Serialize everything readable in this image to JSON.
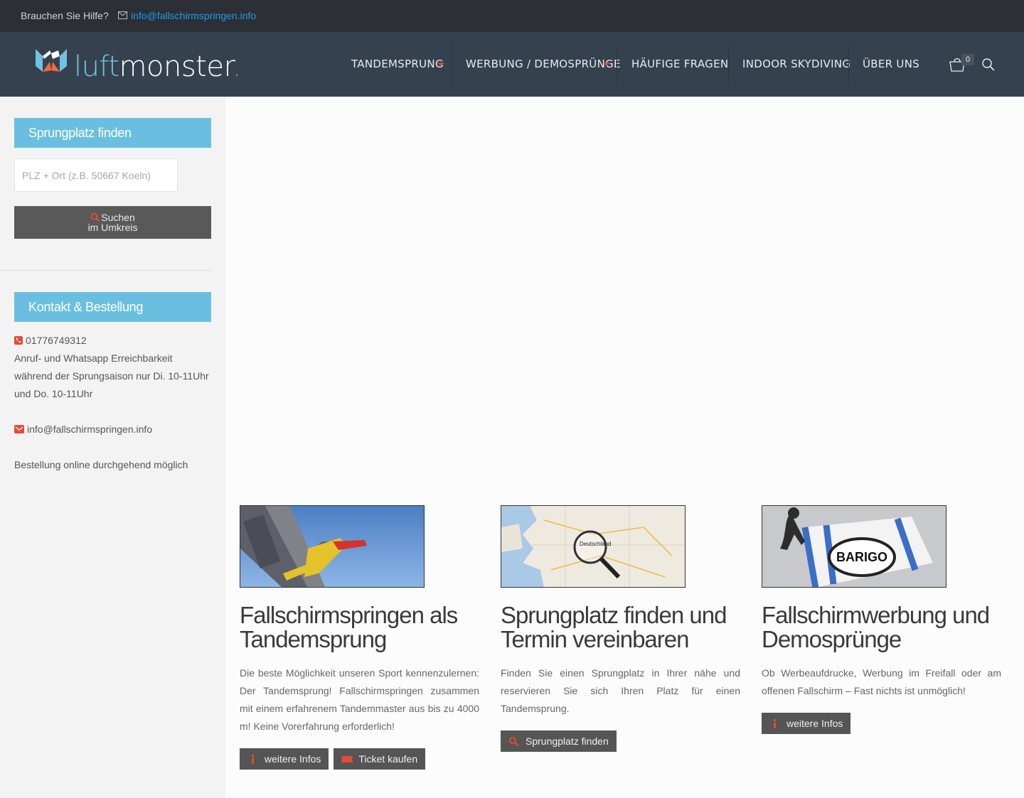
{
  "topbar": {
    "help_text": "Brauchen Sie Hilfe?",
    "email": "info@fallschirmspringen.info"
  },
  "brand": {
    "logo_part1": "luft",
    "logo_part2": "monster",
    "logo_dot": ".",
    "accent_color": "#6abfe0",
    "orange_color": "#f06a3b"
  },
  "nav": {
    "items": [
      {
        "label": "Tandemsprung",
        "has_dropdown": true
      },
      {
        "label": "Werbung / Demosprünge",
        "has_dropdown": true
      },
      {
        "label": "Häufige Fragen",
        "has_dropdown": false
      },
      {
        "label": "Indoor Skydiving",
        "has_dropdown": false
      },
      {
        "label": "Über uns",
        "has_dropdown": false
      }
    ],
    "cart_count": "0"
  },
  "sidebar": {
    "search_widget": {
      "title": "Sprungplatz finden",
      "placeholder": "PLZ + Ort (z.B. 50667 Koeln)",
      "button_line1": "Suchen",
      "button_line2": "im Umkreis"
    },
    "contact_widget": {
      "title": "Kontakt & Bestellung",
      "phone": "01776749312",
      "availability": "Anruf- und Whatsapp Erreichbarkeit während der Sprungsaison nur Di. 10-11Uhr und Do. 10-11Uhr",
      "email": "info@fallschirmspringen.info",
      "order_note": "Bestellung online durchgehend möglich"
    }
  },
  "main": {
    "columns": [
      {
        "heading": "Fallschirmspringen als Tandemsprung",
        "text": "Die beste Möglichkeit unseren Sport kennenzulernen: Der Tandemsprung! Fallschirmspringen zusammen mit einem erfahrenem Tandemmaster aus bis zu 4000 m! Keine Vorerfahrung erforderlich!",
        "buttons": [
          "weitere Infos",
          "Ticket kaufen"
        ]
      },
      {
        "heading": "Sprungplatz finden und Termin vereinbaren",
        "text": "Finden Sie einen Sprungplatz in Ihrer nähe und reservieren Sie sich Ihren Platz für einen Tandemsprung.",
        "buttons": [
          "Sprungplatz finden"
        ]
      },
      {
        "heading": "Fallschirmwerbung und Demosprünge",
        "text": "Ob Werbeaufdrucke, Werbung im Freifall oder am offenen Fallschirm – Fast nichts ist unmöglich!",
        "buttons": [
          "weitere Infos"
        ]
      }
    ],
    "image_labels": {
      "map_country": "Deutschland",
      "banner_brand": "BARIGO"
    }
  }
}
